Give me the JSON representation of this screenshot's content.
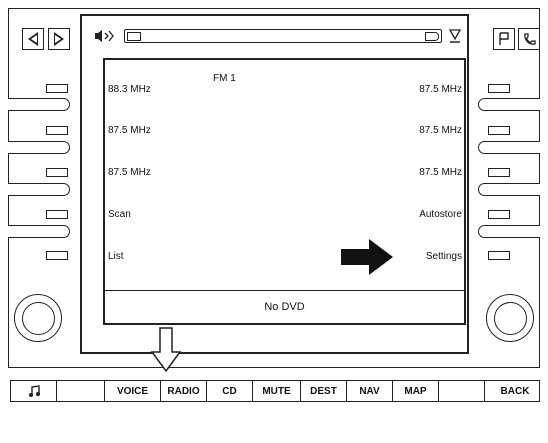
{
  "top_left_buttons": [
    {
      "icon": "seek-back-icon"
    },
    {
      "icon": "seek-forward-icon"
    }
  ],
  "top_right_buttons": [
    {
      "icon": "flag-icon"
    },
    {
      "icon": "phone-icon"
    }
  ],
  "screen": {
    "volume_icon": "audio-source-icon",
    "eject_icon": "eject-icon",
    "band": "FM 1",
    "left_items": [
      "88.3 MHz",
      "87.5 MHz",
      "87.5 MHz",
      "Scan",
      "List"
    ],
    "right_items": [
      "87.5 MHz",
      "87.5 MHz",
      "87.5 MHz",
      "Autostore",
      "Settings"
    ],
    "status": "No DVD"
  },
  "bottom_bar": {
    "buttons": [
      "",
      "VOICE",
      "RADIO",
      "CD",
      "MUTE",
      "DEST",
      "NAV",
      "MAP",
      "",
      "BACK"
    ],
    "music_icon": "music-note-icon"
  },
  "annotations": {
    "arrow_right": "pointer-arrow-right",
    "arrow_down": "pointer-arrow-down"
  }
}
